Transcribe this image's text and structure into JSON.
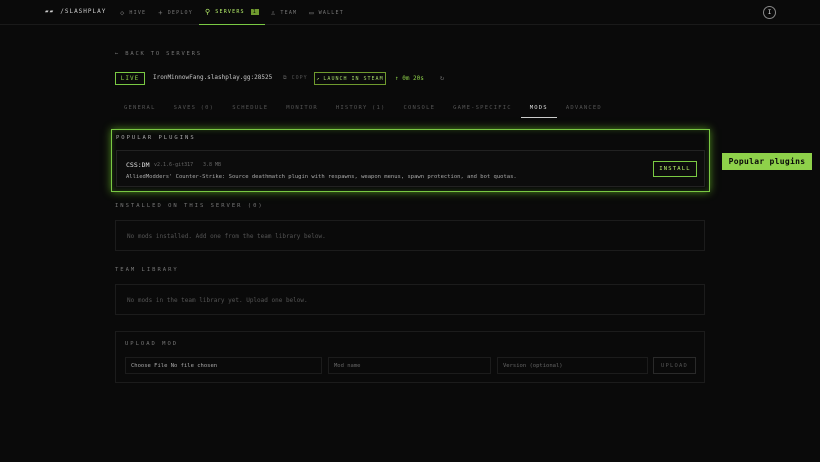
{
  "brand": {
    "mark": "▰▰",
    "name": "/SLASHPLAY"
  },
  "nav": [
    {
      "icon": "◇",
      "label": "HIVE",
      "active": false
    },
    {
      "icon": "+",
      "label": "DEPLOY",
      "active": false
    },
    {
      "icon": "⚲",
      "label": "SERVERS",
      "active": true,
      "badge": "1"
    },
    {
      "icon": "♙",
      "label": "TEAM",
      "active": false
    },
    {
      "icon": "▭",
      "label": "WALLET",
      "active": false
    }
  ],
  "avatar": "I",
  "back_label": "← BACK TO SERVERS",
  "server": {
    "status": "LIVE",
    "host": "IronMinnowFang.slashplay.gg:28525",
    "copy_label": "COPY",
    "steam_label": "LAUNCH IN STEAM",
    "uptime": "↑ 0m 20s",
    "refresh_icon": "↻"
  },
  "tabs": [
    {
      "label": "GENERAL",
      "active": false
    },
    {
      "label": "SAVES (0)",
      "active": false
    },
    {
      "label": "SCHEDULE",
      "active": false
    },
    {
      "label": "MONITOR",
      "active": false
    },
    {
      "label": "HISTORY (1)",
      "active": false
    },
    {
      "label": "CONSOLE",
      "active": false
    },
    {
      "label": "GAME-SPECIFIC",
      "active": false
    },
    {
      "label": "MODS",
      "active": true
    },
    {
      "label": "ADVANCED",
      "active": false
    }
  ],
  "popular": {
    "title": "POPULAR PLUGINS",
    "plugin": {
      "name": "CSS:DM",
      "version": "v2.1.6-git317",
      "size": "3.8 MB",
      "description": "AlliedModders' Counter-Strike: Source deathmatch plugin with respawns, weapon menus, spawn protection, and bot quotas.",
      "install_label": "INSTALL"
    }
  },
  "callout": "Popular plugins",
  "installed": {
    "title": "INSTALLED ON THIS SERVER (0)",
    "empty": "No mods installed. Add one from the team library below."
  },
  "library": {
    "title": "TEAM LIBRARY",
    "empty": "No mods in the team library yet. Upload one below."
  },
  "upload": {
    "title": "UPLOAD MOD",
    "file_label": "Choose File No file chosen",
    "name_placeholder": "Mod name",
    "version_placeholder": "Version (optional)",
    "button": "UPLOAD"
  }
}
